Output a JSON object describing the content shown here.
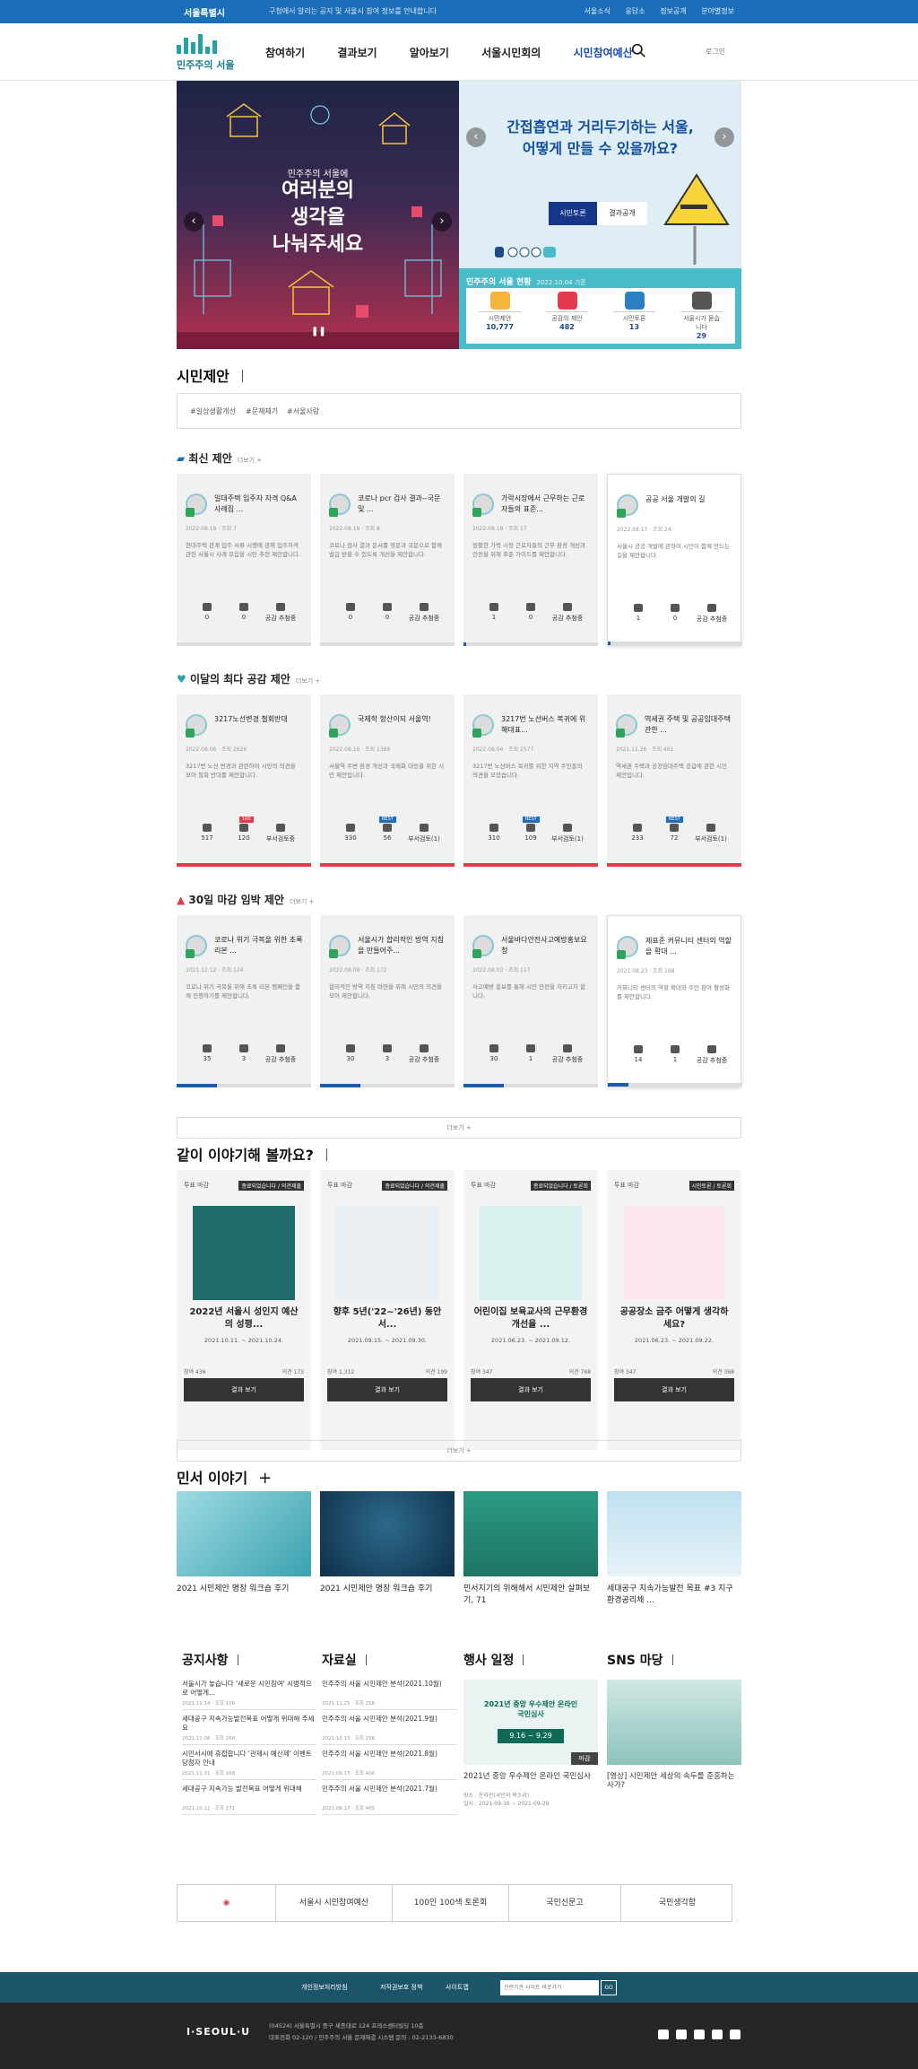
{
  "topbar": {
    "logo": "서울특별시",
    "notice": "구청에서 알리는 공지 및 서울시 참여 정보를 안내합니다",
    "links": [
      "서울소식",
      "응답소",
      "정보공개",
      "분야별정보"
    ]
  },
  "header": {
    "brand": "민주주의 서울",
    "nav": [
      "참여하기",
      "결과보기",
      "알아보기",
      "서울시민회의",
      "시민참여예산"
    ],
    "login": "로그인"
  },
  "hero": {
    "left_small": "민주주의 서울에",
    "left_big": [
      "여러분의",
      "생각을",
      "나눠주세요"
    ],
    "right_title": [
      "간접흡연과 거리두기하는 서울,",
      "어떻게 만들 수 있을까요?"
    ],
    "btn_discuss": "시민토론",
    "btn_result": "결과공개",
    "stats_title": "민주주의 서울 현황",
    "stats_date": "2022.10.04 기준",
    "stats": [
      {
        "label": "시민제안",
        "value": "10,777"
      },
      {
        "label": "공감의 제안",
        "value": "482"
      },
      {
        "label": "시민토론",
        "value": "13"
      },
      {
        "label": "서울시가 묻습니다",
        "value": "29"
      }
    ]
  },
  "proposals": {
    "title": "시민제안",
    "tags": [
      "#일상생활개선",
      "#문제제기",
      "#서울사랑"
    ],
    "latest_title": "최신 제안",
    "more": "더보기 +",
    "latest": [
      {
        "title": "일대주택 입주자 자격 Q&A 사례집 ...",
        "meta": "2022.08.18 · 조회 7",
        "body": "현대주택 관계 입주 서류 시행에 관해 입주자격 관련 서울시 사례 모음을 시민 추천 제안합니다.",
        "likes": "0",
        "comments": "0",
        "prog": 0
      },
      {
        "title": "코로나 pcr 검사 결과--국문 및 ...",
        "meta": "2022.08.18 · 조회 8",
        "body": "코로나 검사 결과 문서를 영문과 국문으로 함께 발급 받을 수 있도록 개선을 제안합니다.",
        "likes": "0",
        "comments": "0",
        "prog": 0
      },
      {
        "title": "가락시장에서 근무하는 근로자들의 표준...",
        "meta": "2022.08.18 · 조회 17",
        "body": "원활한 가락 시장 근로자들의 근무 환경 개선과 안전을 위해 표준 가이드를 제안합니다.",
        "likes": "1",
        "comments": "0",
        "prog": 0.02
      },
      {
        "title": "공공 서울 개발의 길",
        "meta": "2022.08.17 · 조회 24",
        "body": "서울시 공공 개발에 관하여 시민이 함께 만드는 길을 제안합니다.",
        "likes": "1",
        "comments": "0",
        "prog": 0.02
      }
    ],
    "best_title": "이달의 최다 공감 제안",
    "best": [
      {
        "title": "3217노선변경 철회반대",
        "meta": "2022.08.06 · 조회 2626",
        "body": "3217번 노선 변경과 관련하여 시민의 의견을 모아 철회 반대를 제안합니다.",
        "likes": "517",
        "comments": "120",
        "status": "부서검토중",
        "badge": "100"
      },
      {
        "title": "국제학 항산이되 서울역!",
        "meta": "2022.08.16 · 조회 1369",
        "body": "서울역 주변 환경 개선과 국제화 대응을 위한 시민 제안입니다.",
        "likes": "330",
        "comments": "56",
        "status": "부서검토(1)",
        "badge": "BEST"
      },
      {
        "title": "3217번 노선버스 복귀에 위해대표...",
        "meta": "2022.08.04 · 조회 2577",
        "body": "3217번 노선버스 복귀를 위한 지역 주민들의 의견을 모았습니다.",
        "likes": "310",
        "comments": "109",
        "status": "부서검토(1)",
        "badge": "BEST"
      },
      {
        "title": "역세권 주택 및 공공임대주택 관한 ...",
        "meta": "2021.12.26 · 조회 461",
        "body": "역세권 주택과 공공임대주택 공급에 관한 시민 제안입니다.",
        "likes": "233",
        "comments": "72",
        "status": "부서검토(1)",
        "badge": "BEST"
      }
    ],
    "deadline_title": "30일 마감 임박 제안",
    "deadline": [
      {
        "title": "코로나 위기 극복을 위한 초록 리본 ...",
        "meta": "2021.12.12 · 조회 124",
        "body": "코로나 위기 극복을 위해 초록 리본 캠페인을 함께 진행하기를 제안합니다.",
        "likes": "35",
        "comments": "3",
        "status": "공감 추첨중",
        "prog": 0.3
      },
      {
        "title": "서울시가 합리적인 방역 지침을 만들어주...",
        "meta": "2022.08.08 · 조회 172",
        "body": "합리적인 방역 지침 마련을 위해 시민의 의견을 모아 제안합니다.",
        "likes": "30",
        "comments": "3",
        "status": "공감 추첨중",
        "prog": 0.3
      },
      {
        "title": "서울바다안전사고예방홍보요청",
        "meta": "2022.08.03 · 조회 117",
        "body": "사고예방 홍보를 통해 시민 안전을 지키고자 합니다.",
        "likes": "30",
        "comments": "1",
        "status": "공감 추첨중",
        "prog": 0.3
      },
      {
        "title": "제표준 커뮤니티 센터의 역할을 확대 ...",
        "meta": "2021.08.23 · 조회 168",
        "body": "커뮤니티 센터의 역할 확대와 주민 참여 활성화를 제안합니다.",
        "likes": "14",
        "comments": "1",
        "status": "공감 추첨중",
        "prog": 0.15
      }
    ],
    "more_bar": "더보기 +"
  },
  "talk": {
    "title": "같이 이야기해 볼까요?",
    "items": [
      {
        "label": "투표 마감",
        "tag": "종료되었습니다 / 의견제출",
        "title": "2022년 서울시 성인지 예산의 성평...",
        "date": "2021.10.11. ~ 2021.10.24.",
        "left": "참여 436",
        "right": "의견 173",
        "btn": "결과 보기"
      },
      {
        "label": "투표 마감",
        "tag": "종료되었습니다 / 의견제출",
        "title": "향후 5년('22~'26년) 동안 서...",
        "date": "2021.09.15. ~ 2021.09.30.",
        "left": "참여 1,312",
        "right": "의견 199",
        "btn": "결과 보기"
      },
      {
        "label": "투표 마감",
        "tag": "종료되었습니다 / 토론회",
        "title": "어린이집 보육교사의 근무환경 개선을 ...",
        "date": "2021.06.23. ~ 2021.09.12.",
        "left": "참여 347",
        "right": "의견 768",
        "btn": "결과 보기"
      },
      {
        "label": "투표 마감",
        "tag": "시민토론 / 토론회",
        "title": "공공장소 금주 어떻게 생각하세요?",
        "date": "2021.06.23. ~ 2021.09.22.",
        "left": "참여 347",
        "right": "의견 368",
        "btn": "결과 보기"
      }
    ],
    "more_bar": "더보기 +"
  },
  "civil": {
    "title": "민서 이야기",
    "items": [
      {
        "title": "2021 시민제안 명장 워크숍 후기"
      },
      {
        "title": "2021 시민제안 명장 워크숍 후기"
      },
      {
        "title": "민서지기의 위해해서 시민제안 살펴보기, 71"
      },
      {
        "title": "세대공구 지속가능발전 목표 #3 지구 환경공리체 ..."
      }
    ]
  },
  "notice": {
    "title": "공지사항",
    "items": [
      {
        "t": "서울시가 놓습니다 '새로운 시민참여' 시범적으로 어떻게...",
        "m": "2021.11.14 · 조회 136"
      },
      {
        "t": "세대공구 지속가능발전목표 어떻게 위대해 주세요",
        "m": "2021.11.08 · 조회 268"
      },
      {
        "t": "시민서시에 휴접합니다 '관제시 예산제' 이벤트 당첨자 안내",
        "m": "2021.11.01 · 조회 168"
      },
      {
        "t": "세대공구 지속가능 발전목표 어떻게 위대해",
        "m": "2021.10.12 · 조회 271"
      }
    ]
  },
  "data_room": {
    "title": "자료실",
    "items": [
      {
        "t": "민주주의 서울 시민제안 분석(2021.10월)",
        "m": "2021.11.25 · 조회 258"
      },
      {
        "t": "민주주의 서울 시민제안 분석(2021.9월)",
        "m": "2021.10.15 · 조회 296"
      },
      {
        "t": "민주주의 서울 시민제안 분석(2021.8월)",
        "m": "2021.09.13 · 조회 406"
      },
      {
        "t": "민주주의 서울 시민제안 분석(2021.7월)",
        "m": "2021.08.17 · 조회 465"
      }
    ]
  },
  "event": {
    "title": "행사 일정",
    "poster": "2021년 중앙 우수제안 온라인 국민심사",
    "poster_date": "9.16 ~ 9.29",
    "status": "마감",
    "t": "2021년 중앙 우수제안 온라인 국민심사",
    "m": "장소 : 온라인(국민의 목소리)",
    "d": "일시 : 2021-09-16 ~ 2021-09-29"
  },
  "sns": {
    "title": "SNS 마당",
    "t": "[영상] 시민제안 세상의 속두를 준흥하는 사가?"
  },
  "banners": [
    "서울시 시민참여예산",
    "100인 100색 토론회",
    "국민신문고",
    "국민생각함"
  ],
  "footer": {
    "links": [
      "개인정보처리방침",
      "저작권보호 정책",
      "사이트맵"
    ],
    "select": "관련기관 사이트 바로가기",
    "go": "GO",
    "seoul": "I·SEOUL·U",
    "addr1": "(04524) 서울특별시 중구 세종대로 124 프레스센터빌딩 10층",
    "addr2": "대표전화 02-120 / 민주주의 서울 문제해결 시스템 문의 : 02-2133-6830"
  },
  "colors": {
    "primary": "#1a6fb8",
    "teal": "#49bcc9",
    "red": "#e23c4c",
    "dark_footer": "#262626"
  }
}
